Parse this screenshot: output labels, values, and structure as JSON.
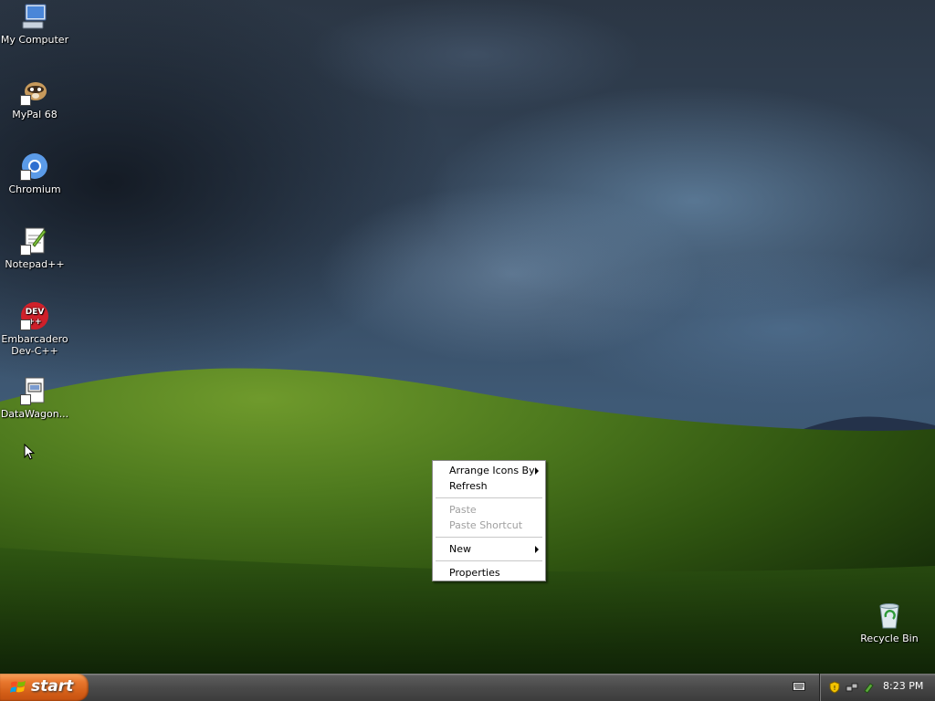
{
  "desktop_icons": [
    {
      "id": "my-computer",
      "label": "My Computer",
      "icon": "computer-icon",
      "shortcut": false
    },
    {
      "id": "mypal",
      "label": "MyPal 68",
      "icon": "mypal-raccoon-icon",
      "shortcut": true
    },
    {
      "id": "chromium",
      "label": "Chromium",
      "icon": "chromium-icon",
      "shortcut": true
    },
    {
      "id": "notepadpp",
      "label": "Notepad++",
      "icon": "notepad-plus-plus-icon",
      "shortcut": true
    },
    {
      "id": "devcpp",
      "label": "Embarcadero Dev-C++",
      "icon": "dev-cpp-icon",
      "shortcut": true
    },
    {
      "id": "datawagon",
      "label": "DataWagon...",
      "icon": "datawagon-icon",
      "shortcut": true
    },
    {
      "id": "recycle-bin",
      "label": "Recycle Bin",
      "icon": "recycle-bin-icon",
      "shortcut": false
    }
  ],
  "context_menu": {
    "arrange_icons_by": "Arrange Icons By",
    "refresh": "Refresh",
    "paste": "Paste",
    "paste_shortcut": "Paste Shortcut",
    "new": "New",
    "properties": "Properties"
  },
  "taskbar": {
    "start_label": "start",
    "clock": "8:23 PM"
  },
  "colors": {
    "start_button": "#d35e17",
    "taskbar": "#4a4a4a",
    "menu_disabled_text": "#a0a0a0"
  }
}
